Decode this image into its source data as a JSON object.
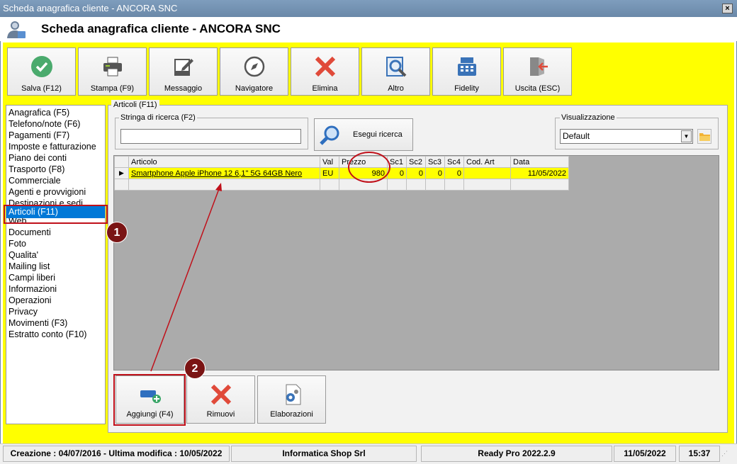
{
  "window": {
    "title": "Scheda anagrafica cliente - ANCORA SNC",
    "close_glyph": "×"
  },
  "header": {
    "title": "Scheda anagrafica cliente - ANCORA SNC",
    "icon": "customer-icon"
  },
  "toolbar": {
    "buttons": [
      {
        "label": "Salva (F12)",
        "icon": "check-icon"
      },
      {
        "label": "Stampa (F9)",
        "icon": "printer-icon"
      },
      {
        "label": "Messaggio",
        "icon": "message-icon"
      },
      {
        "label": "Navigatore",
        "icon": "compass-icon"
      },
      {
        "label": "Elimina",
        "icon": "delete-icon"
      },
      {
        "label": "Altro",
        "icon": "magnifier-icon"
      },
      {
        "label": "Fidelity",
        "icon": "cash-register-icon"
      },
      {
        "label": "Uscita (ESC)",
        "icon": "exit-icon"
      }
    ]
  },
  "sidebar": {
    "items": [
      {
        "label": "Anagrafica (F5)"
      },
      {
        "label": "Telefono/note (F6)"
      },
      {
        "label": "Pagamenti (F7)"
      },
      {
        "label": "Imposte e fatturazione"
      },
      {
        "label": "Piano dei conti"
      },
      {
        "label": "Trasporto (F8)"
      },
      {
        "label": "Commerciale"
      },
      {
        "label": "Agenti e provvigioni"
      },
      {
        "label": "Destinazioni e sedi"
      },
      {
        "label": "Articoli (F11)",
        "selected": true
      },
      {
        "label": "Web"
      },
      {
        "label": "Documenti"
      },
      {
        "label": "Foto"
      },
      {
        "label": "Qualita'"
      },
      {
        "label": "Mailing list"
      },
      {
        "label": "Campi liberi"
      },
      {
        "label": "Informazioni"
      },
      {
        "label": "Operazioni"
      },
      {
        "label": "Privacy"
      },
      {
        "label": "Movimenti (F3)"
      },
      {
        "label": "Estratto conto (F10)"
      }
    ]
  },
  "articoli": {
    "panel_title": "Articoli (F11)",
    "search": {
      "group_label": "Stringa di ricerca (F2)",
      "value": "",
      "button_label": "Esegui ricerca"
    },
    "visualizzazione": {
      "group_label": "Visualizzazione",
      "selected": "Default"
    },
    "grid": {
      "columns": [
        "Articolo",
        "Val",
        "Prezzo",
        "Sc1",
        "Sc2",
        "Sc3",
        "Sc4",
        "Cod. Art",
        "Data"
      ],
      "rows": [
        {
          "articolo": "Smartphone Apple iPhone 12 6,1\" 5G 64GB Nero",
          "val": "EU",
          "prezzo": "980",
          "sc1": "0",
          "sc2": "0",
          "sc3": "0",
          "sc4": "0",
          "cod_art": "",
          "data": "11/05/2022"
        }
      ]
    },
    "bottom_buttons": [
      {
        "label": "Aggiungi (F4)",
        "icon": "add-item-icon"
      },
      {
        "label": "Rimuovi",
        "icon": "remove-icon"
      },
      {
        "label": "Elaborazioni",
        "icon": "process-document-icon"
      }
    ]
  },
  "annotations": {
    "badge1": "1",
    "badge2": "2"
  },
  "statusbar": {
    "dates": "Creazione : 04/07/2016 - Ultima modifica : 10/05/2022",
    "company": "Informatica Shop Srl",
    "version": "Ready Pro 2022.2.9",
    "date": "11/05/2022",
    "time": "15:37"
  },
  "colors": {
    "background_accent": "#ffff00",
    "selection": "#0078d7",
    "annotation": "#c0101a"
  }
}
